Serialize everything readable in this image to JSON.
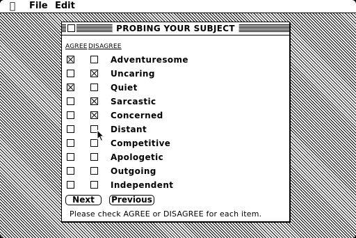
{
  "menubar": {
    "apple_icon": "apple-icon",
    "file_label": "File",
    "edit_label": "Edit"
  },
  "window": {
    "title": "PROBING YOUR SUBJECT",
    "col_agree": "AGREE",
    "col_disagree": "DISAGREE",
    "items": [
      {
        "label": "Adventuresome",
        "agree": true,
        "disagree": false
      },
      {
        "label": "Uncaring",
        "agree": false,
        "disagree": true
      },
      {
        "label": "Quiet",
        "agree": true,
        "disagree": false
      },
      {
        "label": "Sarcastic",
        "agree": false,
        "disagree": true
      },
      {
        "label": "Concerned",
        "agree": false,
        "disagree": true
      },
      {
        "label": "Distant",
        "agree": false,
        "disagree": false
      },
      {
        "label": "Competitive",
        "agree": false,
        "disagree": false
      },
      {
        "label": "Apologetic",
        "agree": false,
        "disagree": false
      },
      {
        "label": "Outgoing",
        "agree": false,
        "disagree": false
      },
      {
        "label": "Independent",
        "agree": false,
        "disagree": false
      }
    ],
    "next_label": "Next",
    "previous_label": "Previous",
    "instruction": "Please check AGREE or DISAGREE for each item."
  },
  "cursor_icon": "arrow-cursor-icon"
}
